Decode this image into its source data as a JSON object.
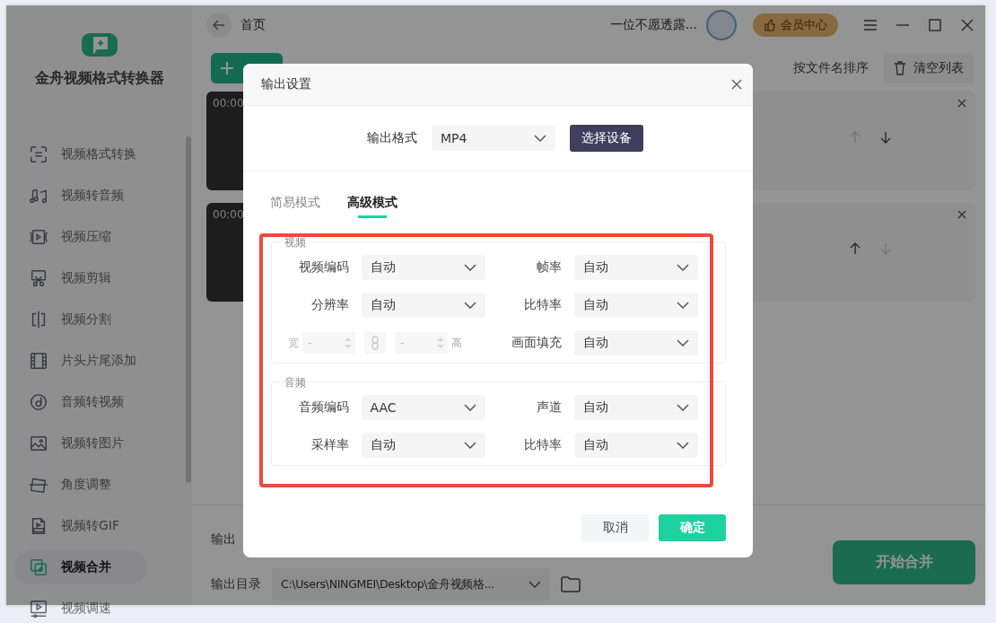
{
  "sidebar": {
    "app_title": "金舟视频格式转换器",
    "items": [
      {
        "label": "视频格式转换",
        "selected": false
      },
      {
        "label": "视频转音频",
        "selected": false
      },
      {
        "label": "视频压缩",
        "selected": false
      },
      {
        "label": "视频剪辑",
        "selected": false
      },
      {
        "label": "视频分割",
        "selected": false
      },
      {
        "label": "片头片尾添加",
        "selected": false
      },
      {
        "label": "音频转视频",
        "selected": false
      },
      {
        "label": "视频转图片",
        "selected": false
      },
      {
        "label": "角度调整",
        "selected": false
      },
      {
        "label": "视频转GIF",
        "selected": false
      },
      {
        "label": "视频合并",
        "selected": true
      },
      {
        "label": "视频调速",
        "selected": false
      }
    ]
  },
  "topbar": {
    "breadcrumb": "首页",
    "username": "一位不愿透露...",
    "vip_button": "会员中心"
  },
  "toolbar": {
    "sort_link": "按文件名排序",
    "clear_button": "清空列表"
  },
  "videos": [
    {
      "duration": "00:00",
      "up_disabled": true,
      "down_disabled": false
    },
    {
      "duration": "00:00",
      "up_disabled": false,
      "down_disabled": true
    }
  ],
  "output": {
    "info_label": "输出",
    "dir_label": "输出目录",
    "dir_value": "C:\\Users\\NINGMEI\\Desktop\\金舟视频格...",
    "start_button": "开始合并"
  },
  "dialog": {
    "title": "输出设置",
    "format_label": "输出格式",
    "format_value": "MP4",
    "device_button": "选择设备",
    "tabs": [
      {
        "label": "简易模式",
        "selected": false
      },
      {
        "label": "高级模式",
        "selected": true
      }
    ],
    "groups": [
      {
        "legend": "视频",
        "rows": [
          {
            "kind": "select",
            "label": "视频编码",
            "value": "自动"
          },
          {
            "kind": "select",
            "label": "帧率",
            "value": "自动"
          },
          {
            "kind": "select",
            "label": "分辨率",
            "value": "自动"
          },
          {
            "kind": "select",
            "label": "比特率",
            "value": "自动"
          },
          {
            "kind": "size",
            "width_label": "宽",
            "width_value": "-",
            "height_label": "高",
            "height_value": "-",
            "disabled": true
          },
          {
            "kind": "select",
            "label": "画面填充",
            "value": "自动"
          }
        ]
      },
      {
        "legend": "音频",
        "rows": [
          {
            "kind": "select",
            "label": "音频编码",
            "value": "AAC"
          },
          {
            "kind": "select",
            "label": "声道",
            "value": "自动"
          },
          {
            "kind": "select",
            "label": "采样率",
            "value": "自动"
          },
          {
            "kind": "select",
            "label": "比特率",
            "value": "自动"
          }
        ]
      }
    ],
    "cancel_button": "取消",
    "ok_button": "确定"
  }
}
